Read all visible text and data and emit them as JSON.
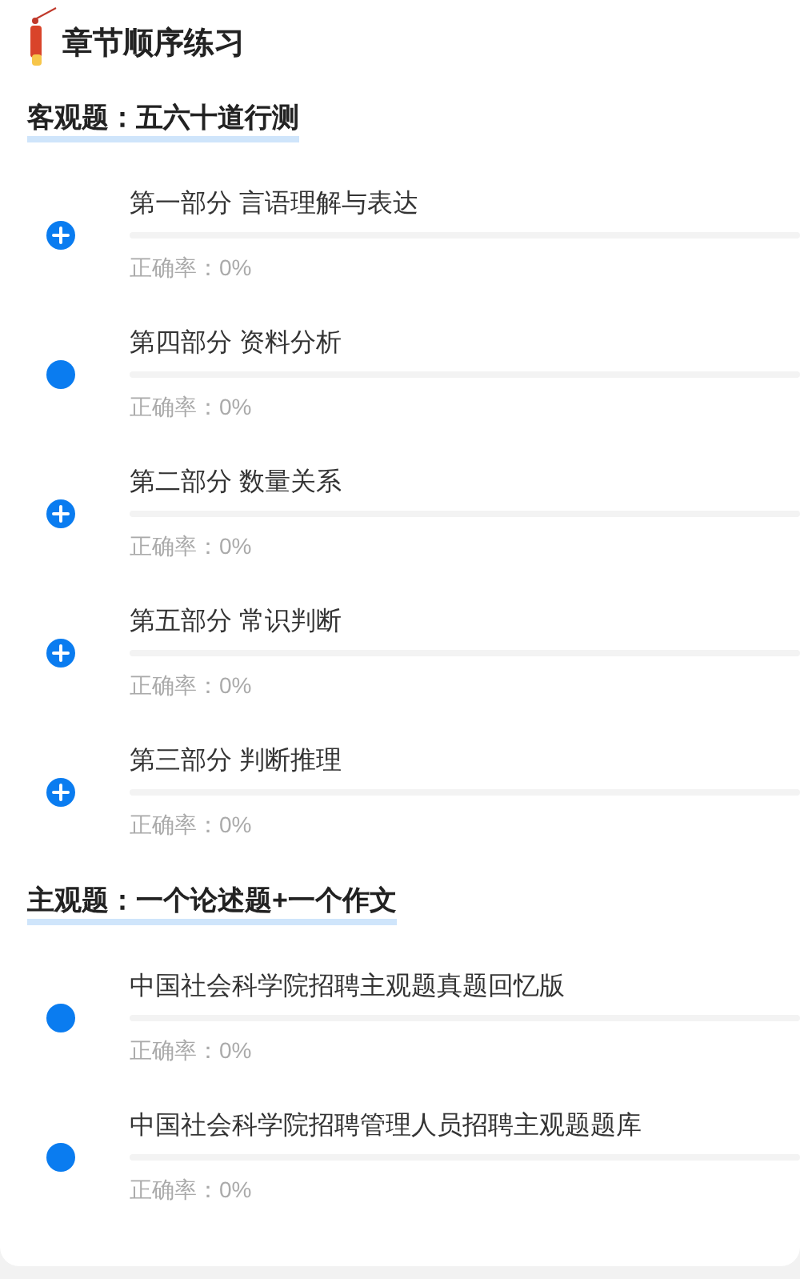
{
  "title": "章节顺序练习",
  "sections": [
    {
      "heading": "客观题：五六十道行测",
      "items": [
        {
          "kind": "expandable",
          "name": "第一部分 言语理解与表达",
          "level": 0,
          "accuracy": "正确率：0%"
        },
        {
          "kind": "leaf",
          "name": "第四部分 资料分析",
          "level": 0,
          "accuracy": "正确率：0%"
        },
        {
          "kind": "expandable",
          "name": "第二部分 数量关系",
          "level": 0,
          "accuracy": "正确率：0%"
        },
        {
          "kind": "expandable",
          "name": "第五部分 常识判断",
          "level": 0,
          "accuracy": "正确率：0%"
        },
        {
          "kind": "expandable",
          "name": "第三部分 判断推理",
          "level": 0,
          "accuracy": "正确率：0%"
        }
      ]
    },
    {
      "heading": "主观题：一个论述题+一个作文",
      "items": [
        {
          "kind": "leaf",
          "name": "中国社会科学院招聘主观题真题回忆版",
          "level": 0,
          "accuracy": "正确率：0%"
        },
        {
          "kind": "leaf",
          "name": "中国社会科学院招聘管理人员招聘主观题题库",
          "level": 0,
          "accuracy": "正确率：0%"
        }
      ]
    }
  ]
}
